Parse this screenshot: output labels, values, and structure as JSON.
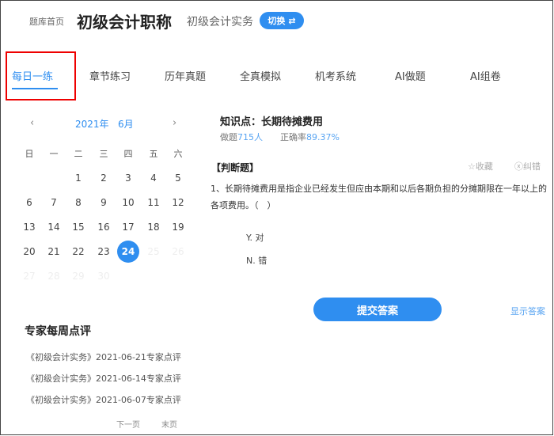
{
  "header": {
    "home": "题库首页",
    "title": "初级会计职称",
    "subject": "初级会计实务",
    "switch_label": "切换",
    "switch_icon": "⇄"
  },
  "tabs": [
    "每日一练",
    "章节练习",
    "历年真题",
    "全真模拟",
    "机考系统",
    "AI做题",
    "AI组卷"
  ],
  "calendar": {
    "year": "2021年",
    "month": "6月",
    "prev": "‹",
    "next": "›",
    "weekdays": [
      "日",
      "一",
      "二",
      "三",
      "四",
      "五",
      "六"
    ],
    "first_weekday": 2,
    "days_in_month": 30,
    "selected": 24
  },
  "review": {
    "title": "专家每周点评",
    "items": [
      "《初级会计实务》2021-06-21专家点评",
      "《初级会计实务》2021-06-14专家点评",
      "《初级会计实务》2021-06-07专家点评"
    ],
    "next": "下一页",
    "last": "末页"
  },
  "question": {
    "knowledge": "知识点：长期待摊费用",
    "done_label": "做题",
    "done_count": "715人",
    "rate_label": "正确率",
    "rate": "89.37%",
    "type": "【判断题】",
    "favorite": "收藏",
    "report": "纠错",
    "text": "1、长期待摊费用是指企业已经发生但应由本期和以后各期负担的分摊期限在一年以上的各项费用。（　）",
    "options": [
      "Y. 对",
      "N. 错"
    ],
    "submit": "提交答案",
    "show_answer": "显示答案"
  }
}
